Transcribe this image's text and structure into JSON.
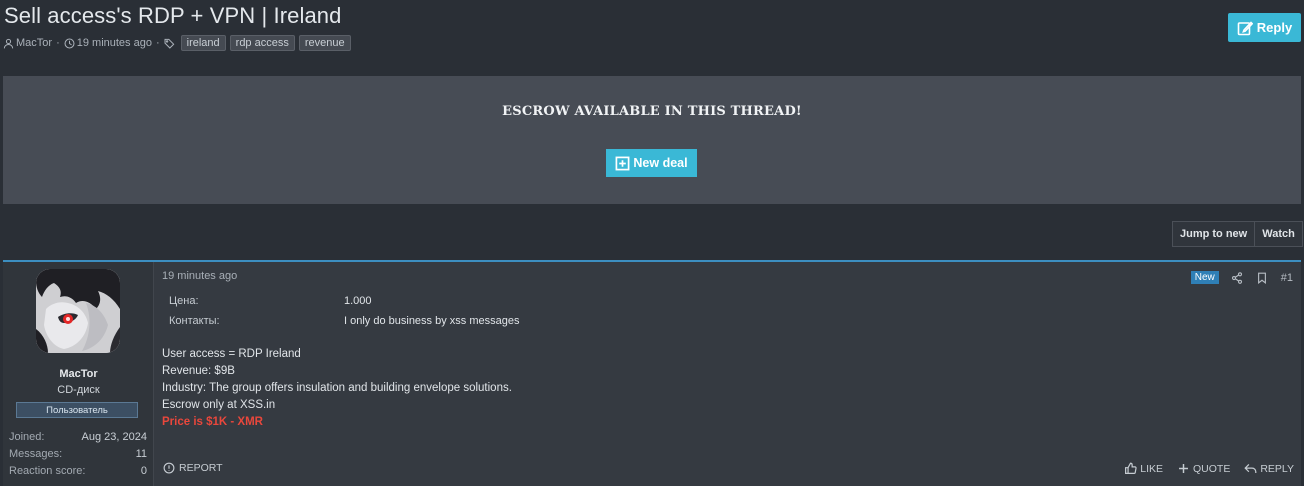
{
  "thread": {
    "title": "Sell access's RDP + VPN | Ireland",
    "author": "MacTor",
    "time": "19 minutes ago",
    "sep": "·",
    "tags": [
      "ireland",
      "rdp access",
      "revenue"
    ],
    "reply_label": "Reply"
  },
  "escrow": {
    "title": "ESCROW AVAILABLE IN THIS THREAD!",
    "button_label": "New deal"
  },
  "thread_actions": {
    "jump_label": "Jump to new",
    "watch_label": "Watch"
  },
  "post": {
    "time": "19 minutes ago",
    "new_badge": "New",
    "number": "#1",
    "fields": [
      {
        "label": "Цена:",
        "value": "1.000"
      },
      {
        "label": "Контакты:",
        "value": "I only do business by xss messages"
      }
    ],
    "body": [
      "User access = RDP Ireland",
      "Revenue: $9B",
      "Industry: The group offers insulation and building envelope solutions.",
      "Escrow only at XSS.in"
    ],
    "price_line": "Price is $1K - XMR",
    "report_label": "REPORT",
    "like_label": "LIKE",
    "quote_label": "QUOTE",
    "reply_label": "REPLY"
  },
  "user": {
    "name": "MacTor",
    "title": "CD-диск",
    "banner": "Пользователь",
    "stats": [
      {
        "label": "Joined:",
        "value": "Aug 23, 2024"
      },
      {
        "label": "Messages:",
        "value": "11"
      },
      {
        "label": "Reaction score:",
        "value": "0"
      }
    ]
  },
  "colors": {
    "accent": "#3ab8d6",
    "price": "#e9473c",
    "new_badge": "#2f7fb6"
  },
  "icons": [
    "user-icon",
    "clock-icon",
    "tag-icon",
    "edit-icon",
    "plus-square-icon",
    "share-icon",
    "bookmark-icon",
    "report-icon",
    "like-icon",
    "plus-icon",
    "reply-icon"
  ]
}
